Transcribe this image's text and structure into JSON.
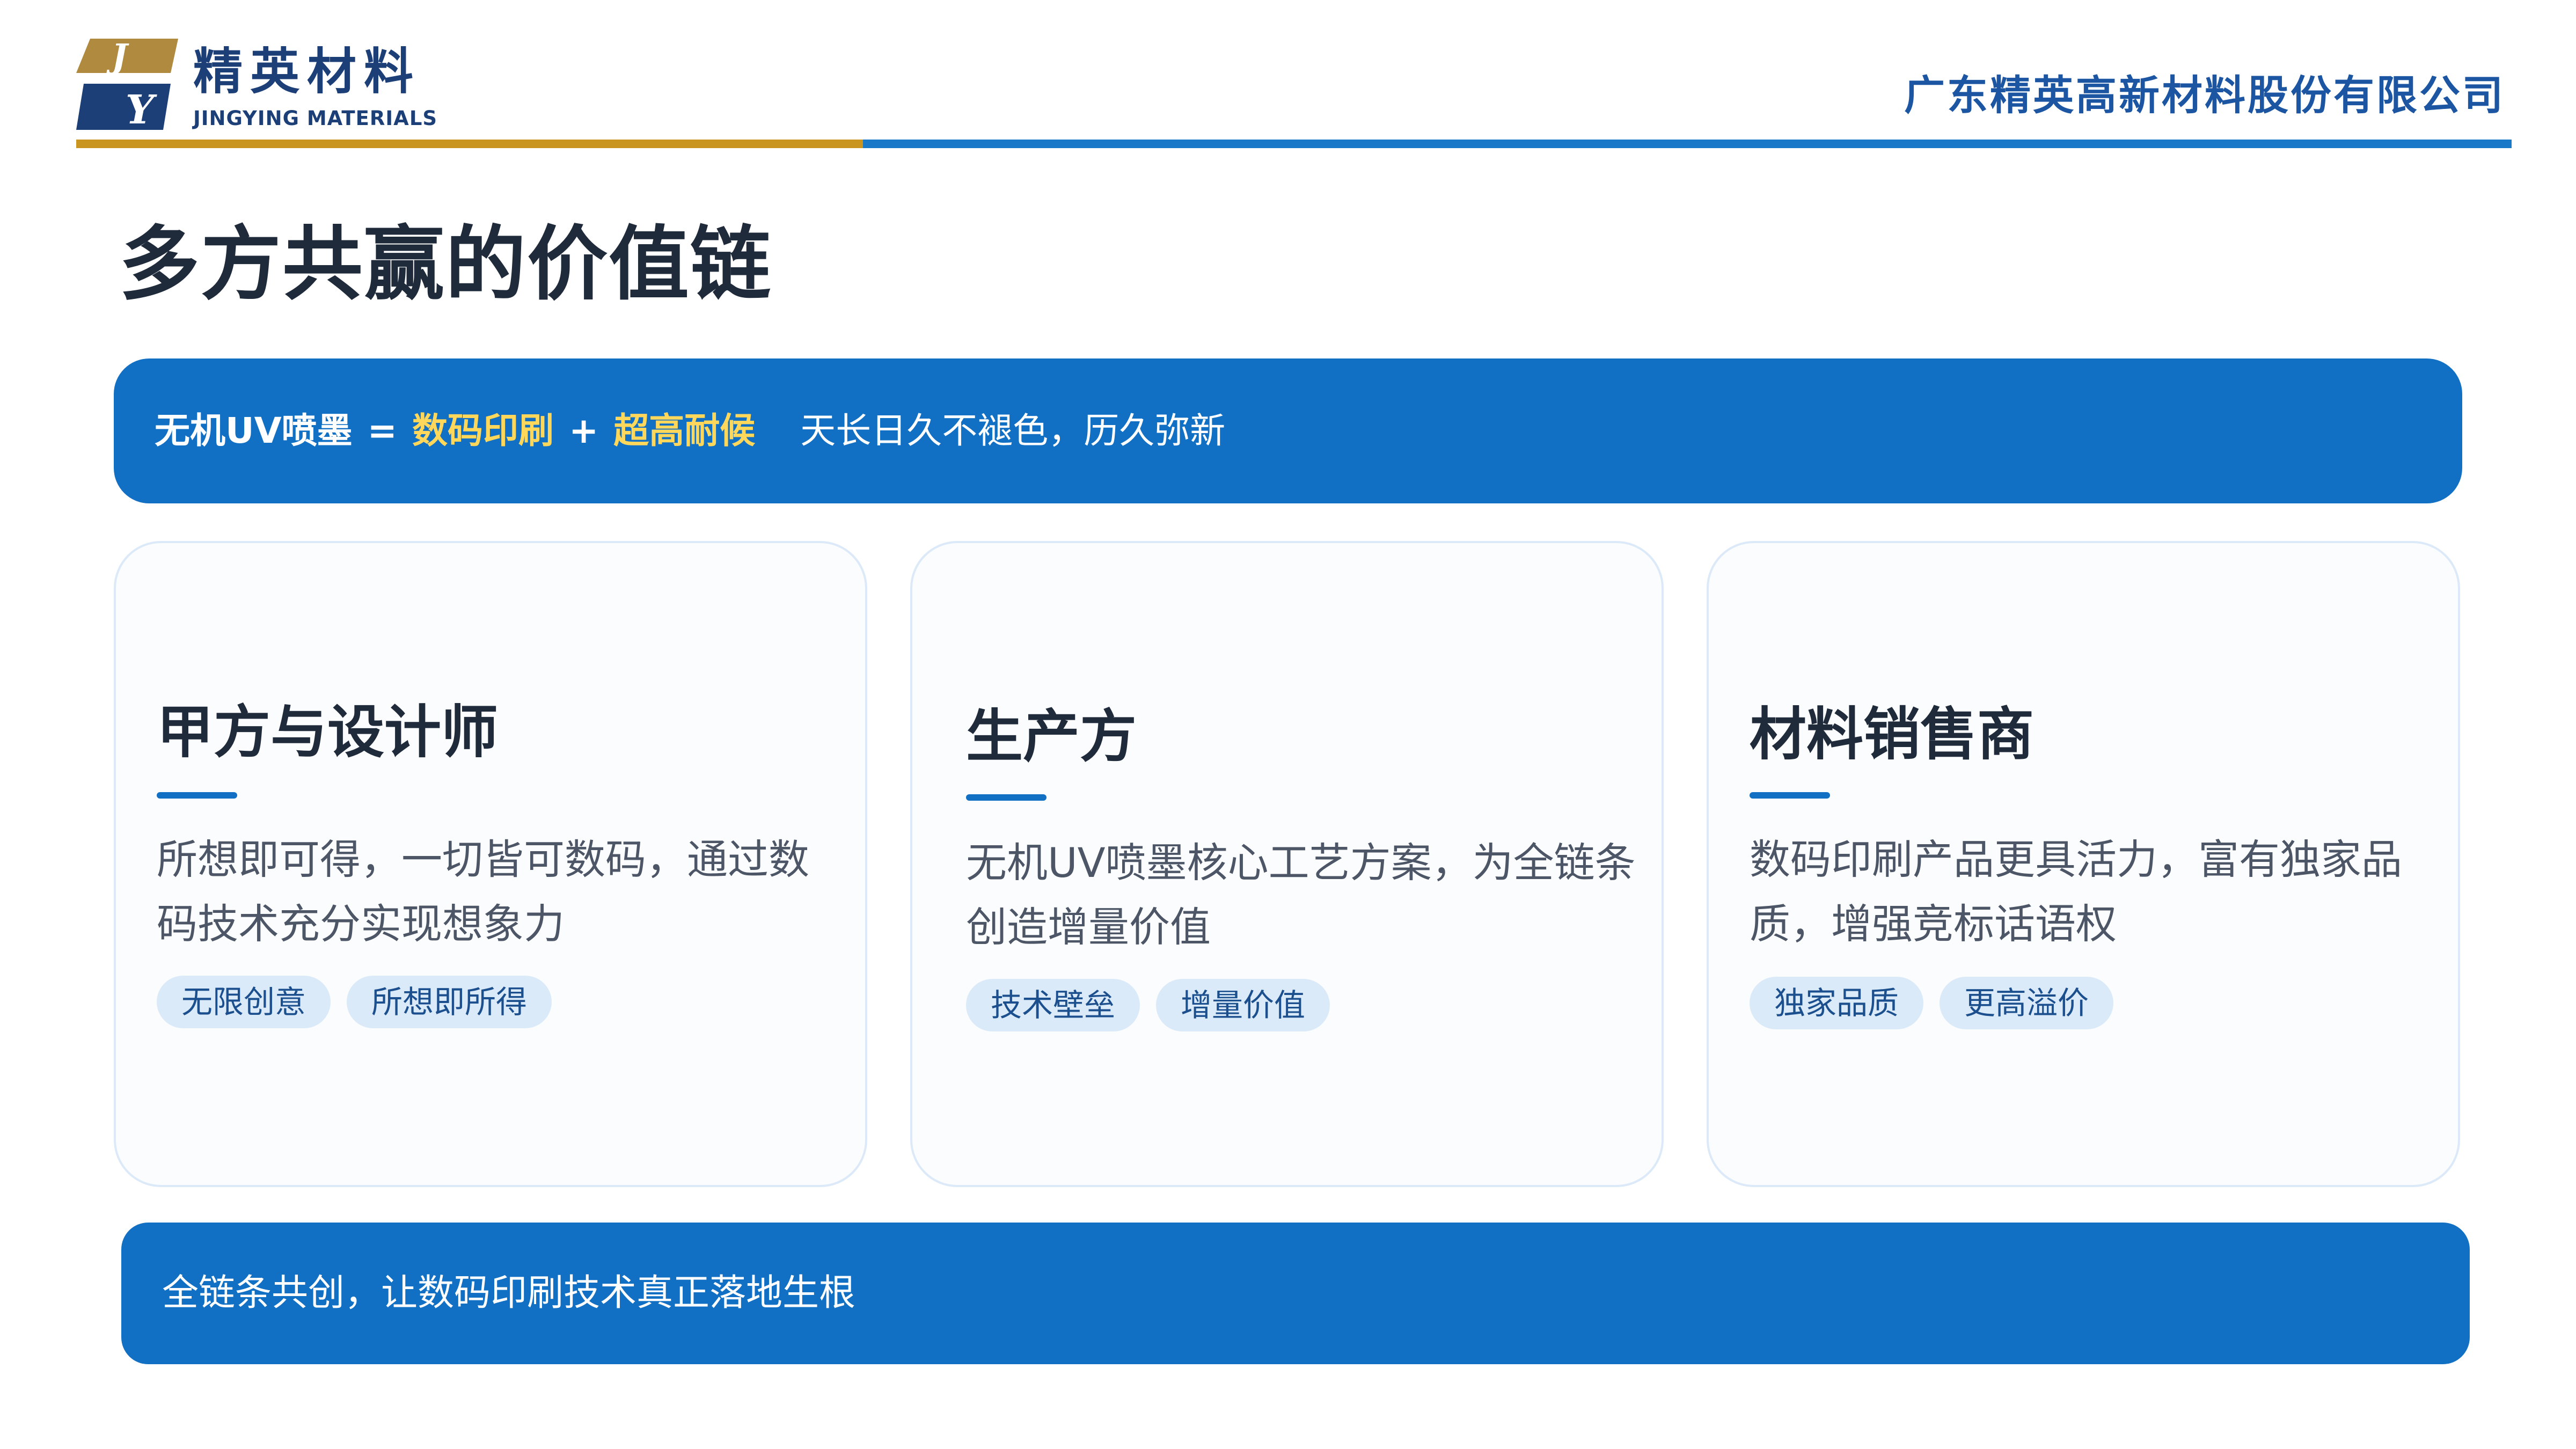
{
  "header": {
    "logo": {
      "mark_letters": [
        "J",
        "Y"
      ],
      "name_cn": "精英材料",
      "name_en": "JINGYING MATERIALS"
    },
    "company_name": "广东精英高新材料股份有限公司",
    "rule_colors": [
      "#c9951e",
      "#1a78c8"
    ]
  },
  "title": "多方共赢的价值链",
  "top_banner": {
    "term": "无机UV喷墨",
    "equals": "=",
    "highlight_1": "数码印刷",
    "plus": "+",
    "highlight_2": "超高耐候",
    "tagline": "天长日久不褪色，历久弥新"
  },
  "cards": [
    {
      "title": "甲方与设计师",
      "desc": "所想即可得，一切皆可数码，通过数码技术充分实现想象力",
      "tags": [
        "无限创意",
        "所想即所得"
      ]
    },
    {
      "title": "生产方",
      "desc": "无机UV喷墨核心工艺方案，为全链条创造增量价值",
      "tags": [
        "技术壁垒",
        "增量价值"
      ]
    },
    {
      "title": "材料销售商",
      "desc": "数码印刷产品更具活力，富有独家品质，增强竞标话语权",
      "tags": [
        "独家品质",
        "更高溢价"
      ]
    }
  ],
  "bottom_banner": {
    "text": "全链条共创，让数码印刷技术真正落地生根"
  },
  "colors": {
    "brand_blue": "#1270c4",
    "brand_gold": "#c9951e",
    "highlight_yellow": "#ffd75a",
    "title_dark": "#1f2a3a",
    "tag_bg": "#dbeaf9"
  }
}
